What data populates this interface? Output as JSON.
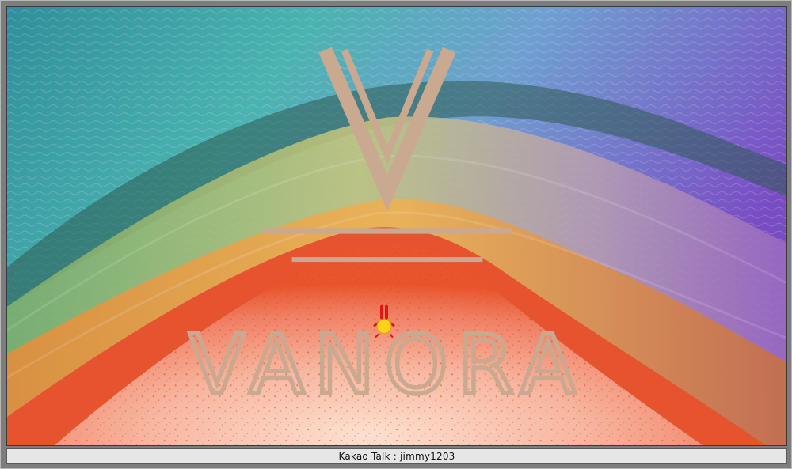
{
  "watermark": {
    "brand": "VANORA",
    "color": "#c9a98f"
  },
  "caption": {
    "text": "Kakao Talk : jimmy1203"
  },
  "colors": {
    "frame": "#7d7d7d",
    "caption_bg": "#e6e6e6",
    "ocean_teal": "#3aa7a8",
    "ocean_purple": "#7a4fc0",
    "sand_pink": "#f39a86",
    "sand_orange": "#e8542c",
    "figure_yellow": "#ffd21e",
    "figure_red": "#e01616"
  }
}
